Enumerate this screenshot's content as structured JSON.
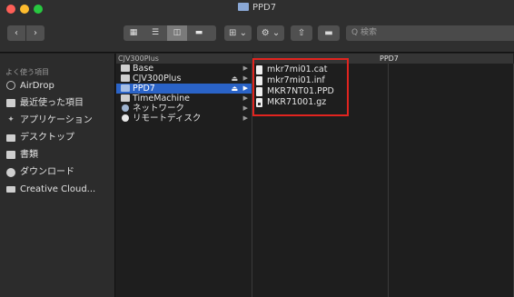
{
  "window": {
    "title": "PPD7"
  },
  "toolbar": {
    "back_glyph": "‹",
    "forward_glyph": "›",
    "view_icons": [
      "icon-view-icon",
      "list-view-icon",
      "column-view-icon",
      "gallery-view-icon"
    ],
    "arrange_glyph": "⊞ ⌄",
    "action_glyph": "⚙ ⌄",
    "share_glyph": "⇧",
    "tag_glyph": "▬",
    "search_placeholder": "Q 検索"
  },
  "path_bar": {
    "left": "CJV300Plus",
    "right": "PPD7"
  },
  "sidebar": {
    "section_title": "よく使う項目",
    "items": [
      {
        "label": "AirDrop",
        "icon": "airdrop-icon"
      },
      {
        "label": "最近使った項目",
        "icon": "recents-icon"
      },
      {
        "label": "アプリケーション",
        "icon": "applications-icon"
      },
      {
        "label": "デスクトップ",
        "icon": "desktop-icon"
      },
      {
        "label": "書類",
        "icon": "documents-icon"
      },
      {
        "label": "ダウンロード",
        "icon": "downloads-icon"
      },
      {
        "label": "Creative Cloud...",
        "icon": "creative-cloud-icon"
      }
    ]
  },
  "column1": {
    "rows": [
      {
        "label": "Base",
        "icon": "folder",
        "eject": "",
        "arrow": "▶"
      },
      {
        "label": "CJV300Plus",
        "icon": "drive",
        "eject": "⏏",
        "arrow": "▶"
      },
      {
        "label": "PPD7",
        "icon": "folder",
        "eject": "⏏",
        "arrow": "▶",
        "selected": true
      },
      {
        "label": "TimeMachine",
        "icon": "drive",
        "eject": "",
        "arrow": "▶"
      },
      {
        "label": "ネットワーク",
        "icon": "network",
        "eject": "",
        "arrow": "▶"
      },
      {
        "label": "リモートディスク",
        "icon": "remote-disk",
        "eject": "",
        "arrow": "▶"
      }
    ]
  },
  "column2": {
    "files": [
      {
        "label": "mkr7mi01.cat"
      },
      {
        "label": "mkr7mi01.inf"
      },
      {
        "label": "MKR7NT01.PPD"
      },
      {
        "label": "MKR71001.gz"
      }
    ]
  },
  "colors": {
    "selection": "#2a63c7",
    "highlight_border": "#e2241f",
    "window_bg": "#1e1e1e",
    "sidebar_bg": "#2c2c2c"
  }
}
